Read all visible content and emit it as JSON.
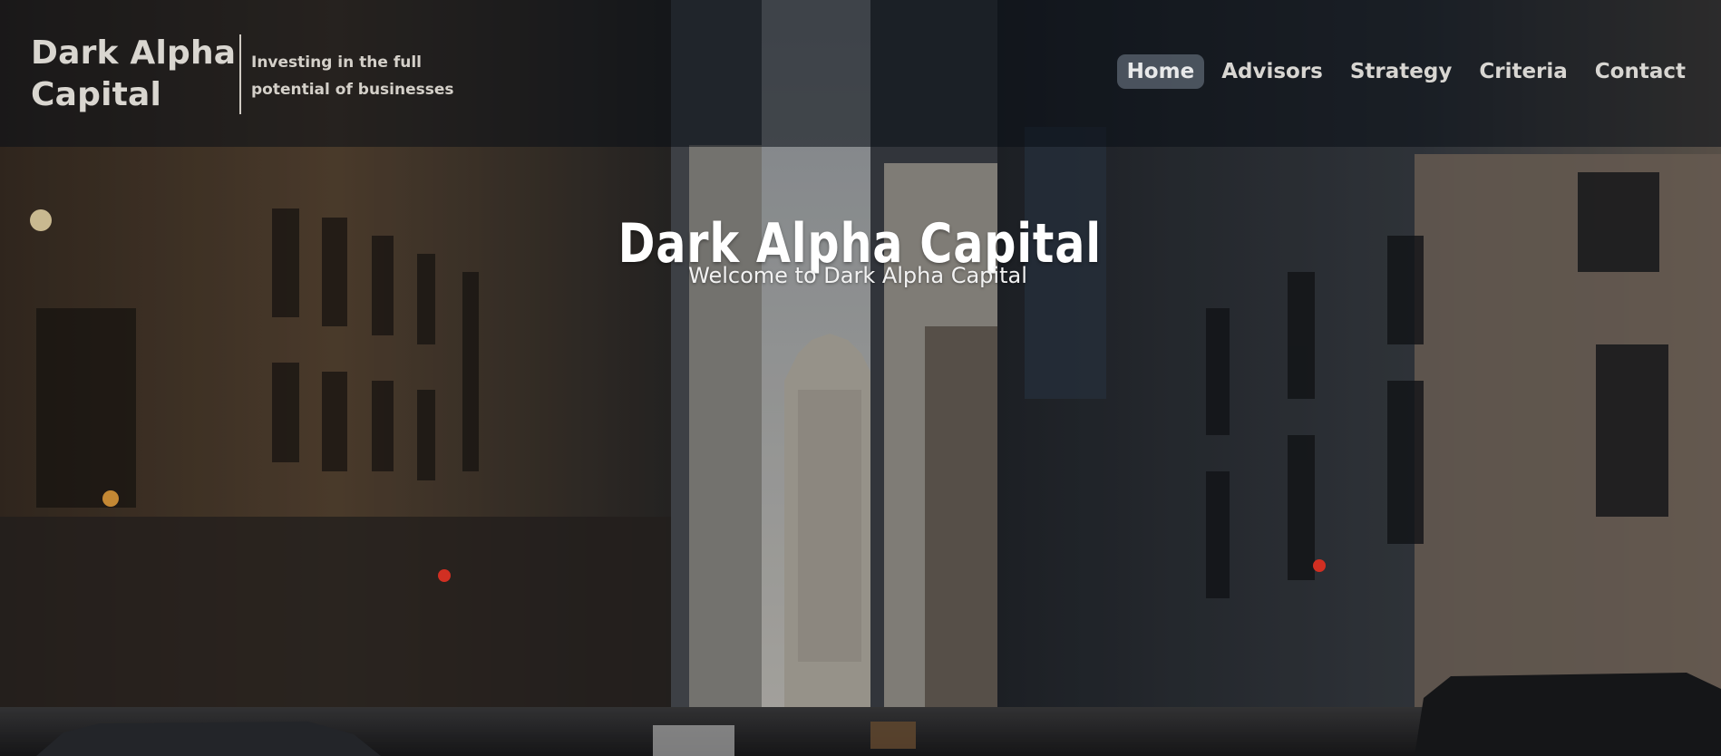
{
  "brand": {
    "name": "Dark Alpha Capital",
    "tagline": "Investing in the full potential of businesses"
  },
  "nav": {
    "items": [
      {
        "label": "Home",
        "active": true
      },
      {
        "label": "Advisors",
        "active": false
      },
      {
        "label": "Strategy",
        "active": false
      },
      {
        "label": "Criteria",
        "active": false
      },
      {
        "label": "Contact",
        "active": false
      }
    ]
  },
  "hero": {
    "title": "Dark Alpha Capital",
    "subtitle": "Welcome to Dark Alpha Capital",
    "background": "city-street-skyscrapers-photo"
  },
  "colors": {
    "header_overlay": "#0a0e16",
    "active_nav_bg": "#8c98a8",
    "text": "#ffffff"
  }
}
